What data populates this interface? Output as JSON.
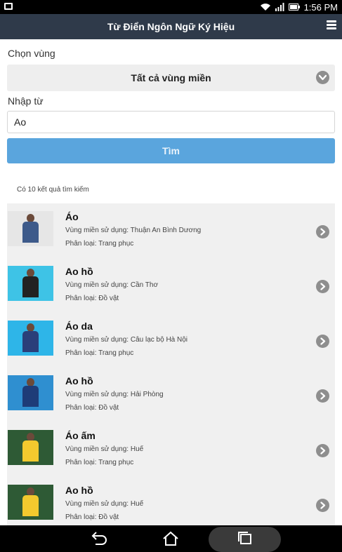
{
  "status": {
    "time": "1:56 PM"
  },
  "app": {
    "title": "Từ Điển Ngôn Ngữ Ký Hiệu"
  },
  "form": {
    "region_label": "Chọn vùng",
    "region_value": "Tất cả vùng miền",
    "word_label": "Nhập từ",
    "word_value": "Ao",
    "search_label": "Tìm"
  },
  "results": {
    "count_text": "Có 10 kết quả tìm kiếm",
    "items": [
      {
        "name": "Áo",
        "region": "Vùng miền sử dụng: Thuận An Bình Dương",
        "category": "Phân loại: Trang phục",
        "thumb_bg": "#e6e6e6",
        "shirt": "#3d5a8a"
      },
      {
        "name": "Ao hồ",
        "region": "Vùng miền sử dụng: Cần Thơ",
        "category": "Phân loại: Đồ vật",
        "thumb_bg": "#3ec3e6",
        "shirt": "#222222"
      },
      {
        "name": "Áo da",
        "region": "Vùng miền sử dụng: Câu lạc bộ Hà Nội",
        "category": "Phân loại: Trang phục",
        "thumb_bg": "#2eb5e8",
        "shirt": "#2a3f7a"
      },
      {
        "name": "Ao hồ",
        "region": "Vùng miền sử dụng: Hải Phòng",
        "category": "Phân loại: Đồ vật",
        "thumb_bg": "#2f8fd0",
        "shirt": "#1e3c78"
      },
      {
        "name": "Áo ấm",
        "region": "Vùng miền sử dụng: Huế",
        "category": "Phân loại: Trang phục",
        "thumb_bg": "#2e5a35",
        "shirt": "#f2c92e"
      },
      {
        "name": "Ao hồ",
        "region": "Vùng miền sử dụng: Huế",
        "category": "Phân loại: Đồ vật",
        "thumb_bg": "#2e5a35",
        "shirt": "#f2c92e"
      }
    ]
  },
  "icons": {
    "status_left": "screenshot-icon",
    "wifi": "wifi-icon",
    "signal": "signal-icon",
    "battery": "battery-icon",
    "menu": "menu-icon",
    "dropdown": "chevron-down-icon",
    "row_go": "chevron-right-icon",
    "back": "back-icon",
    "home": "home-icon",
    "recent": "recent-apps-icon"
  },
  "colors": {
    "app_bar": "#2f3a4a",
    "search_button": "#5aa5dd",
    "panel": "#f0f0f0"
  }
}
